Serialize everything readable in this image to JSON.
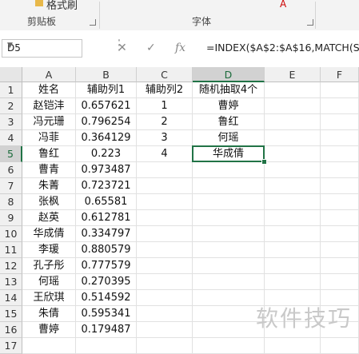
{
  "ribbon": {
    "format_painter_label": "格式刷",
    "clipboard_label": "剪贴板",
    "font_label": "字体"
  },
  "formula_bar": {
    "name_box": "D5",
    "formula": "=INDEX($A$2:$A$16,MATCH(SM"
  },
  "columns": [
    "A",
    "B",
    "C",
    "D",
    "E",
    "F"
  ],
  "rows": [
    "1",
    "2",
    "3",
    "4",
    "5",
    "6",
    "7",
    "8",
    "9",
    "10",
    "11",
    "12",
    "13",
    "14",
    "15",
    "16",
    "17"
  ],
  "active_cell": "D5",
  "grid": [
    [
      "姓名",
      "辅助列1",
      "辅助列2",
      "随机抽取4个",
      "",
      ""
    ],
    [
      "赵铠沣",
      "0.657621",
      "1",
      "曹婷",
      "",
      ""
    ],
    [
      "冯元珊",
      "0.796254",
      "2",
      "鲁红",
      "",
      ""
    ],
    [
      "冯菲",
      "0.364129",
      "3",
      "何瑶",
      "",
      ""
    ],
    [
      "鲁红",
      "0.223",
      "4",
      "华成倩",
      "",
      ""
    ],
    [
      "曹青",
      "0.973487",
      "",
      "",
      "",
      ""
    ],
    [
      "朱菁",
      "0.723721",
      "",
      "",
      "",
      ""
    ],
    [
      "张枫",
      "0.65581",
      "",
      "",
      "",
      ""
    ],
    [
      "赵英",
      "0.612781",
      "",
      "",
      "",
      ""
    ],
    [
      "华成倩",
      "0.334797",
      "",
      "",
      "",
      ""
    ],
    [
      "李瑗",
      "0.880579",
      "",
      "",
      "",
      ""
    ],
    [
      "孔子彤",
      "0.777579",
      "",
      "",
      "",
      ""
    ],
    [
      "何瑶",
      "0.270395",
      "",
      "",
      "",
      ""
    ],
    [
      "王欣琪",
      "0.514592",
      "",
      "",
      "",
      ""
    ],
    [
      "朱倩",
      "0.595341",
      "",
      "",
      "",
      ""
    ],
    [
      "曹婷",
      "0.179487",
      "",
      "",
      "",
      ""
    ],
    [
      "",
      "",
      "",
      "",
      "",
      ""
    ]
  ],
  "watermark": "软件技巧",
  "colors": {
    "accent": "#217346",
    "grid_line": "#e1e1e1",
    "header_bg": "#f0f0f0"
  }
}
